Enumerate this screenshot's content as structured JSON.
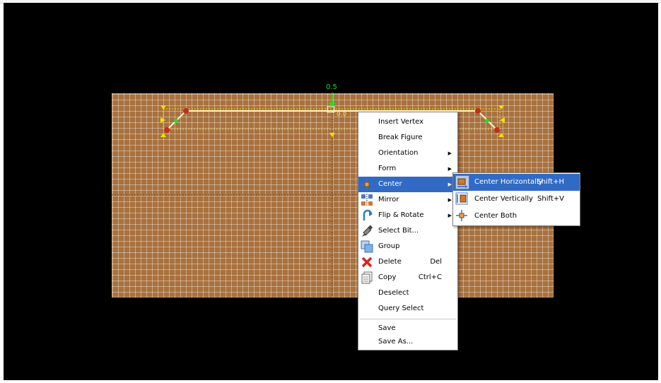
{
  "canvas": {
    "dimension_label": "0.5",
    "dimension_label_2": "0.0"
  },
  "context_menu": {
    "items": [
      {
        "label": "Insert Vertex"
      },
      {
        "label": "Break Figure"
      },
      {
        "label": "Orientation"
      },
      {
        "label": "Form"
      },
      {
        "label": "Center"
      },
      {
        "label": "Mirror"
      },
      {
        "label": "Flip & Rotate"
      },
      {
        "label": "Select Bit..."
      },
      {
        "label": "Group"
      },
      {
        "label": "Delete",
        "shortcut": "Del"
      },
      {
        "label": "Copy",
        "shortcut": "Ctrl+C"
      },
      {
        "label": "Deselect"
      },
      {
        "label": "Query Select"
      },
      {
        "label": "Save"
      },
      {
        "label": "Save As..."
      }
    ]
  },
  "center_submenu": {
    "items": [
      {
        "label": "Center Horizontally",
        "shortcut": "Shift+H"
      },
      {
        "label": "Center Vertically",
        "shortcut": "Shift+V"
      },
      {
        "label": "Center Both"
      }
    ]
  },
  "colors": {
    "canvas_bg": "#000000",
    "board": "#a8713e",
    "highlight": "#316ac5",
    "dimension_green": "#22dd22",
    "handle_yellow": "#f2e100",
    "vertex_red": "#c0301a"
  }
}
